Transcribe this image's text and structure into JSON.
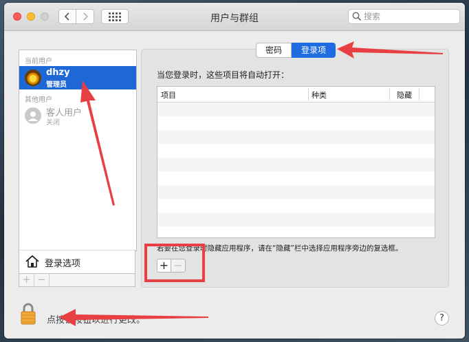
{
  "window": {
    "title": "用户与群组",
    "search_placeholder": "搜索"
  },
  "sidebar": {
    "current_users_header": "当前用户",
    "other_users_header": "其他用户",
    "users": [
      {
        "name": "dhzy",
        "role": "管理员"
      },
      {
        "name": "客人用户",
        "role": "关闭"
      }
    ],
    "login_options_label": "登录选项",
    "add_label": "+",
    "remove_label": "−"
  },
  "tabs": [
    {
      "label": "密码"
    },
    {
      "label": "登录项"
    }
  ],
  "panel": {
    "description": "当您登录时，这些项目将自动打开：",
    "columns": [
      "项目",
      "种类",
      "隐藏"
    ],
    "hint": "若要在您登录时隐藏应用程序，请在“隐藏”栏中选择应用程序旁边的复选框。",
    "add_label": "+",
    "remove_label": "−"
  },
  "footer": {
    "lock_text": "点按锁按钮以进行更改。",
    "help_label": "?"
  },
  "colors": {
    "selection": "#1d67d6",
    "annotation": "#e84042"
  }
}
